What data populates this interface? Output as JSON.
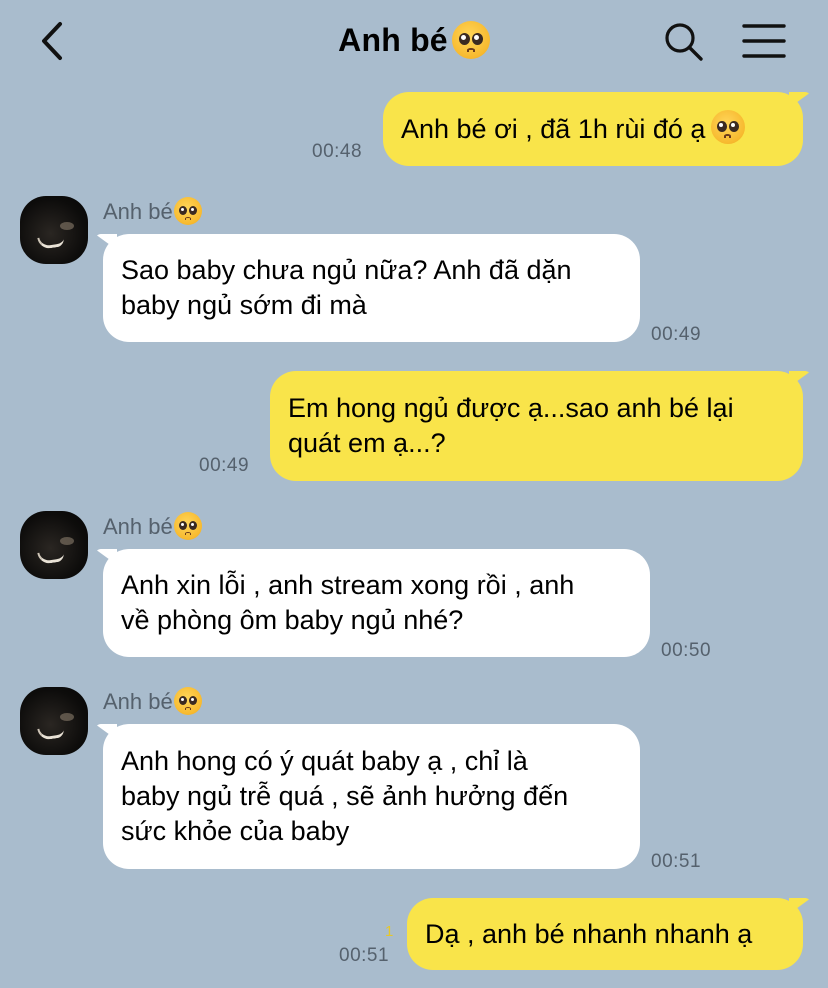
{
  "header": {
    "title": "Anh bé",
    "title_emoji": "pleading-face-emoji"
  },
  "icons": {
    "back": "chevron-left-icon",
    "search": "search-icon",
    "menu": "hamburger-menu-icon"
  },
  "colors": {
    "background": "#a9bccd",
    "outgoing_bubble": "#f9e44a",
    "incoming_bubble": "#ffffff",
    "timestamp": "#55616d",
    "unread_marker": "#e6c72a"
  },
  "messages": [
    {
      "direction": "out",
      "text": "Anh bé ơi , đã 1h rùi đó ạ",
      "emoji": "pleading-face-emoji",
      "time": "00:48"
    },
    {
      "direction": "in",
      "sender": "Anh bé",
      "text": "Sao baby chưa ngủ nữa? Anh đã dặn\nbaby ngủ sớm đi mà",
      "time": "00:49"
    },
    {
      "direction": "out",
      "text": "Em hong ngủ được ạ...sao anh bé lại\nquát em ạ...?",
      "time": "00:49"
    },
    {
      "direction": "in",
      "sender": "Anh bé",
      "text": "Anh xin lỗi , anh stream xong rồi , anh\nvề phòng ôm baby ngủ nhé?",
      "time": "00:50"
    },
    {
      "direction": "in",
      "sender": "Anh bé",
      "text": "Anh hong có ý quát baby ạ , chỉ là\nbaby ngủ trễ quá , sẽ ảnh hưởng đến\nsức khỏe của baby",
      "time": "00:51"
    },
    {
      "direction": "out",
      "text": "Dạ , anh bé nhanh nhanh ạ",
      "time": "00:51",
      "unread": "1"
    }
  ]
}
